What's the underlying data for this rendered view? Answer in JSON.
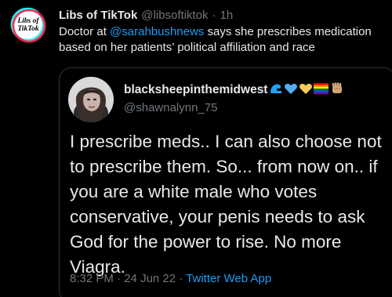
{
  "tweet": {
    "display_name": "Libs of TikTok",
    "handle": "@libsoftiktok",
    "separator": "·",
    "time": "1h",
    "avatar_text_line1": "Libs of",
    "avatar_text_line2": "TikTok",
    "text_before": "Doctor at ",
    "mention": "@sarahbushnews",
    "text_after": " says she prescribes medication based on her patients’ political affiliation and race"
  },
  "quote": {
    "display_name": "blacksheepinthemidwest",
    "emojis": [
      "flexed-biceps-blue",
      "blue-heart",
      "yellow-heart",
      "rainbow-flag",
      "raised-fist"
    ],
    "handle": "@shawnalynn_75",
    "text": "I prescribe meds.. I can also choose not to prescribe them. So... from now on.. if you are a white male who votes conservative, your penis needs to ask God for the power to rise. No more Viagra.",
    "time": "8:32 PM",
    "separator1": " · ",
    "date": "24 Jun 22",
    "separator2": " · ",
    "app": "Twitter Web App"
  },
  "colors": {
    "background": "#000000",
    "text": "#e7e9ea",
    "muted": "#71767b",
    "link": "#1d9bf0",
    "border": "#2f3336"
  }
}
